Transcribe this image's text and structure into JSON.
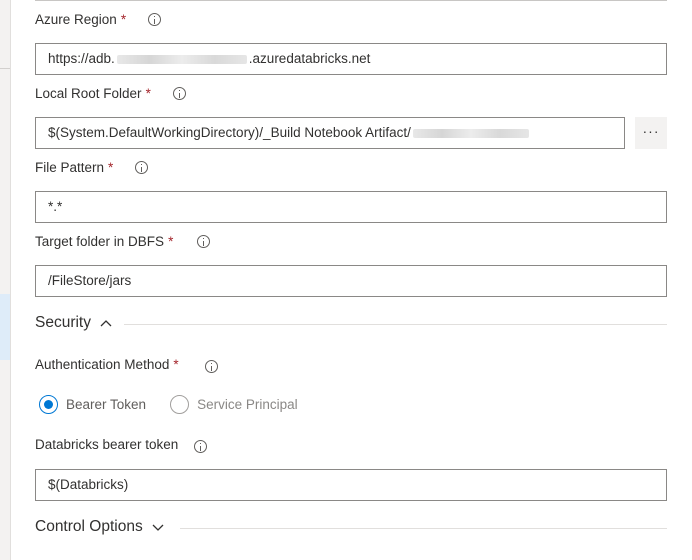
{
  "fields": {
    "azure_region": {
      "label": "Azure Region",
      "value_prefix": "https://adb.",
      "value_suffix": ".azuredatabricks.net"
    },
    "local_root_folder": {
      "label": "Local Root Folder",
      "value": "$(System.DefaultWorkingDirectory)/_Build Notebook Artifact/",
      "browse_label": "···"
    },
    "file_pattern": {
      "label": "File Pattern",
      "value": "*.*"
    },
    "target_folder": {
      "label": "Target folder in DBFS",
      "value": "/FileStore/jars"
    },
    "auth_method": {
      "label": "Authentication Method",
      "options": [
        "Bearer Token",
        "Service Principal"
      ],
      "selected": "Bearer Token"
    },
    "bearer_token": {
      "label": "Databricks bearer token",
      "value": "$(Databricks)"
    }
  },
  "required_marker": "*",
  "sections": {
    "security": "Security",
    "control_options": "Control Options"
  },
  "colors": {
    "accent": "#0078d4",
    "required": "#a4262c",
    "border": "#8a8886"
  }
}
